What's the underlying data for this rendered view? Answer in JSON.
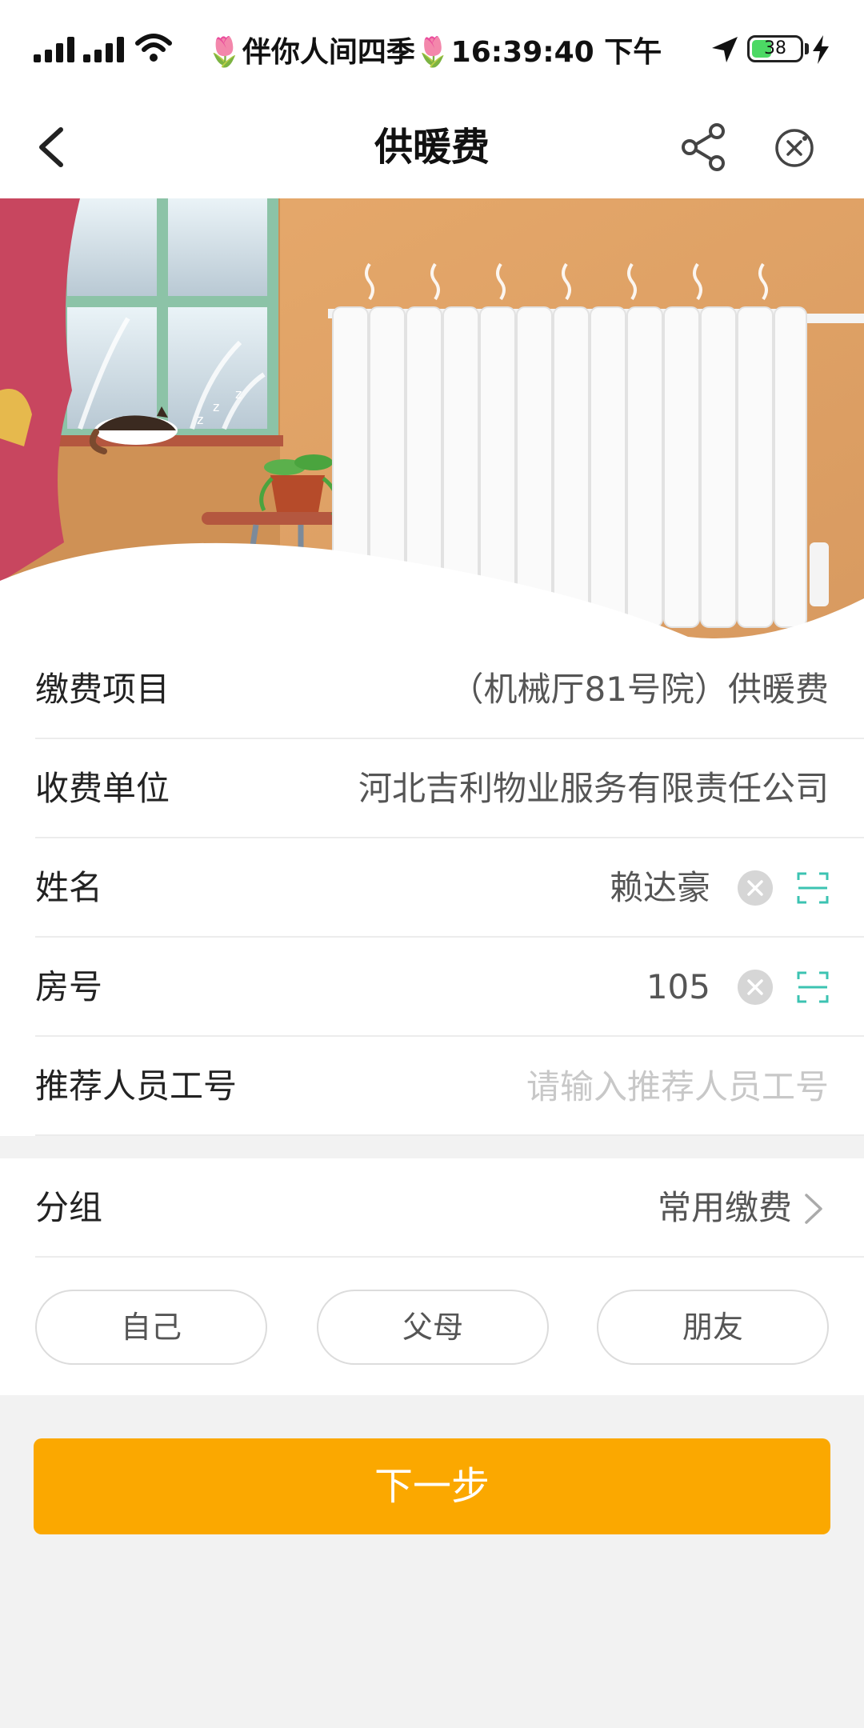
{
  "status_bar": {
    "carrier_text": "🌷伴你人间四季🌷16:39:40 下午",
    "battery": "38"
  },
  "nav": {
    "title": "供暖费"
  },
  "form": {
    "rows": [
      {
        "label": "缴费项目",
        "value": "（机械厅81号院）供暖费"
      },
      {
        "label": "收费单位",
        "value": "河北吉利物业服务有限责任公司"
      },
      {
        "label": "姓名",
        "value": "赖达豪"
      },
      {
        "label": "房号",
        "value": "105"
      },
      {
        "label": "推荐人员工号",
        "placeholder": "请输入推荐人员工号"
      }
    ]
  },
  "group": {
    "label": "分组",
    "value": "常用缴费",
    "chips": [
      "自己",
      "父母",
      "朋友"
    ]
  },
  "next_button": "下一步",
  "colors": {
    "accent": "#fba800",
    "scan_icon": "#3cc3b2",
    "battery": "#4cd964"
  },
  "icons": [
    "back-arrow-icon",
    "share-icon",
    "close-mini-program-icon",
    "clear-icon",
    "scan-icon",
    "chevron-right-icon"
  ]
}
